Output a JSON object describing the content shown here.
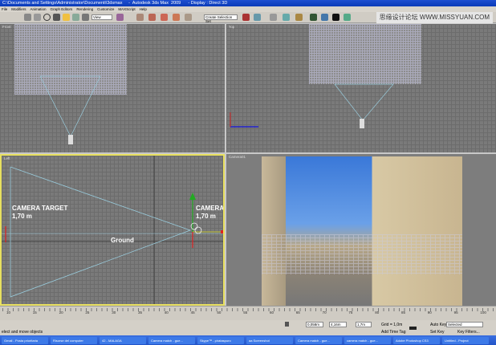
{
  "title": "C:\\Documents and Settings\\Administrator\\Documenti\\3dsmax     -  Autodesk 3ds Max  2009      - Display : Direct 3D",
  "menu": [
    "File",
    "Modifiers",
    "Animation",
    "Graph Editors",
    "Rendering",
    "Customize",
    "MAXScript",
    "Help"
  ],
  "toolbar": {
    "view_select": "View",
    "selection_set": "Create Selection Set"
  },
  "watermark": "思缘设计论坛  WWW.MISSYUAN.COM",
  "viewports": {
    "top_left": "Front",
    "top_right": "Top",
    "bottom_left": "Left",
    "bottom_right": "Camera01"
  },
  "annotations": {
    "target": "CAMERA TARGET",
    "target_height": "1,70 m",
    "camera": "CAMERA",
    "camera_height": "1,70 m",
    "ground": "Ground"
  },
  "timeline": {
    "ticks": [
      "10",
      "15",
      "20",
      "25",
      "30",
      "35",
      "40",
      "45",
      "50",
      "55",
      "60",
      "65",
      "70",
      "75",
      "80",
      "85",
      "90",
      "95",
      "100"
    ]
  },
  "status": {
    "prompt": "elect and move objects",
    "x": "0,058m",
    "y": "4,16m",
    "z": "1,7m",
    "grid": "Grid = 1,0m",
    "add_time_tag": "Add Time Tag",
    "auto_key": "Auto Key",
    "selected": "Selected",
    "set_key": "Set Key",
    "key_filters": "Key Filters..."
  },
  "taskbar": [
    "Gmail - Posta prioritaria",
    "Risorse del computer",
    "42 - MALAGA",
    "Camera match - gue...",
    "Skype™ - pirataspuro",
    "aa Screenshot",
    "Camera match - gue...",
    "camera match - gue...",
    "Adobe Photoshop CS3",
    "Untitled - Project"
  ],
  "colors": {
    "active_border": "#e8e060",
    "title_bar": "#1e4fd0",
    "viewport_bg": "#7a7a7a"
  }
}
